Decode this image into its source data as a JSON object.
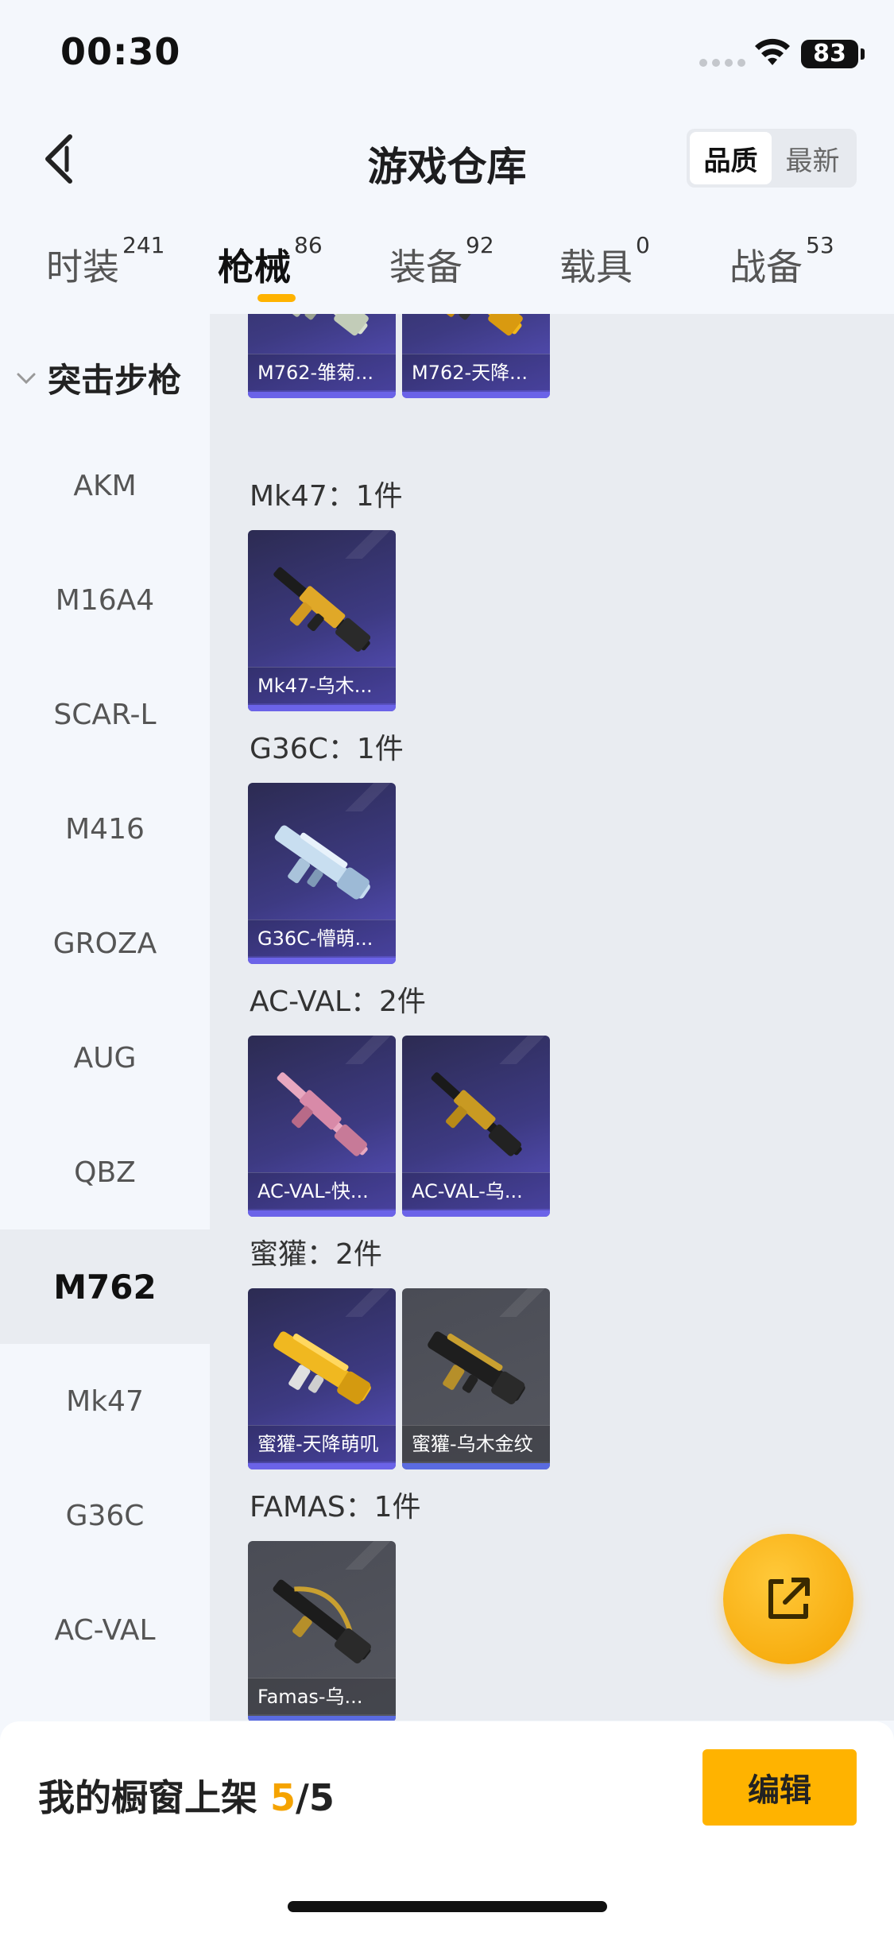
{
  "status": {
    "time": "00:30",
    "battery": "83"
  },
  "header": {
    "title": "游戏仓库",
    "sort_options": [
      "品质",
      "最新"
    ],
    "sort_active": "品质"
  },
  "tabs": [
    {
      "label": "时装",
      "count": "241"
    },
    {
      "label": "枪械",
      "count": "86",
      "active": true
    },
    {
      "label": "装备",
      "count": "92"
    },
    {
      "label": "载具",
      "count": "0"
    },
    {
      "label": "战备",
      "count": "53"
    }
  ],
  "sidebar": {
    "group": "突击步枪",
    "items": [
      "AKM",
      "M16A4",
      "SCAR-L",
      "M416",
      "GROZA",
      "AUG",
      "QBZ",
      "M762",
      "Mk47",
      "G36C",
      "AC-VAL"
    ],
    "active": "M762"
  },
  "sections": [
    {
      "title": "",
      "items": [
        {
          "name": "M762-雏菊...",
          "rarity": "purple",
          "icon": "rifle-m762-white-skin"
        },
        {
          "name": "M762-天降...",
          "rarity": "purple",
          "icon": "rifle-m762-gold-skin"
        }
      ]
    },
    {
      "title": "Mk47：1件",
      "items": [
        {
          "name": "Mk47-乌木...",
          "rarity": "purple",
          "icon": "rifle-mk47-gold-skin"
        }
      ]
    },
    {
      "title": "G36C：1件",
      "items": [
        {
          "name": "G36C-懵萌...",
          "rarity": "purple",
          "icon": "rifle-g36c-blue-skin"
        }
      ]
    },
    {
      "title": "AC-VAL：2件",
      "items": [
        {
          "name": "AC-VAL-快...",
          "rarity": "purple",
          "icon": "rifle-acval-pink-skin"
        },
        {
          "name": "AC-VAL-乌...",
          "rarity": "purple",
          "icon": "rifle-acval-black-gold-skin"
        }
      ]
    },
    {
      "title": "蜜獾：2件",
      "items": [
        {
          "name": "蜜獾-天降萌叽",
          "rarity": "purple",
          "icon": "rifle-honeybadger-gold-skin"
        },
        {
          "name": "蜜獾-乌木金纹",
          "rarity": "gray",
          "icon": "rifle-honeybadger-black-gold-skin"
        }
      ]
    },
    {
      "title": "FAMAS：1件",
      "items": [
        {
          "name": "Famas-乌...",
          "rarity": "gray",
          "icon": "rifle-famas-black-gold-skin"
        }
      ]
    }
  ],
  "bottom": {
    "showcase_label": "我的橱窗上架",
    "showcase_current": "5",
    "showcase_total": "/5",
    "edit_label": "编辑"
  },
  "colors": {
    "accent": "#ffb300",
    "rare_purple": "#3d3a82",
    "common_gray": "#55575f"
  }
}
